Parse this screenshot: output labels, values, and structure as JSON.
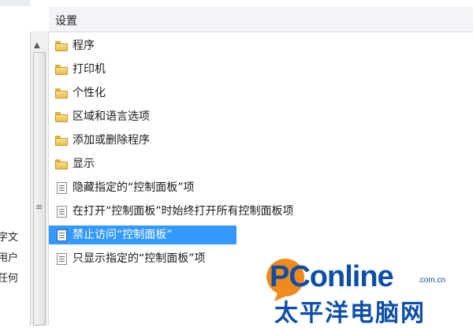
{
  "header": {
    "title": "设置"
  },
  "left_pane": {
    "fragments": [
      "字文",
      "用户",
      "任何"
    ]
  },
  "items": [
    {
      "type": "folder",
      "label": "程序",
      "selected": false
    },
    {
      "type": "folder",
      "label": "打印机",
      "selected": false
    },
    {
      "type": "folder",
      "label": "个性化",
      "selected": false
    },
    {
      "type": "folder",
      "label": "区域和语言选项",
      "selected": false
    },
    {
      "type": "folder",
      "label": "添加或删除程序",
      "selected": false
    },
    {
      "type": "folder",
      "label": "显示",
      "selected": false
    },
    {
      "type": "setting",
      "label": "隐藏指定的“控制面板”项",
      "selected": false
    },
    {
      "type": "setting",
      "label": "在打开“控制面板”时始终打开所有控制面板项",
      "selected": false
    },
    {
      "type": "setting",
      "label": "禁止访问“控制面板”",
      "selected": true
    },
    {
      "type": "setting",
      "label": "只显示指定的“控制面板”项",
      "selected": false
    }
  ],
  "icons": {
    "folder": "folder-icon",
    "setting": "policy-setting-icon",
    "scroll_up": "arrow-up-icon",
    "grip": "scroll-grip-icon"
  },
  "colors": {
    "selection": "#3399ff",
    "watermark": "#0d4fa8",
    "folder": "#e9bd4c"
  },
  "watermark": {
    "brand": "PConline",
    "domain": ".com.cn",
    "name_cn": "太平洋电脑网"
  }
}
